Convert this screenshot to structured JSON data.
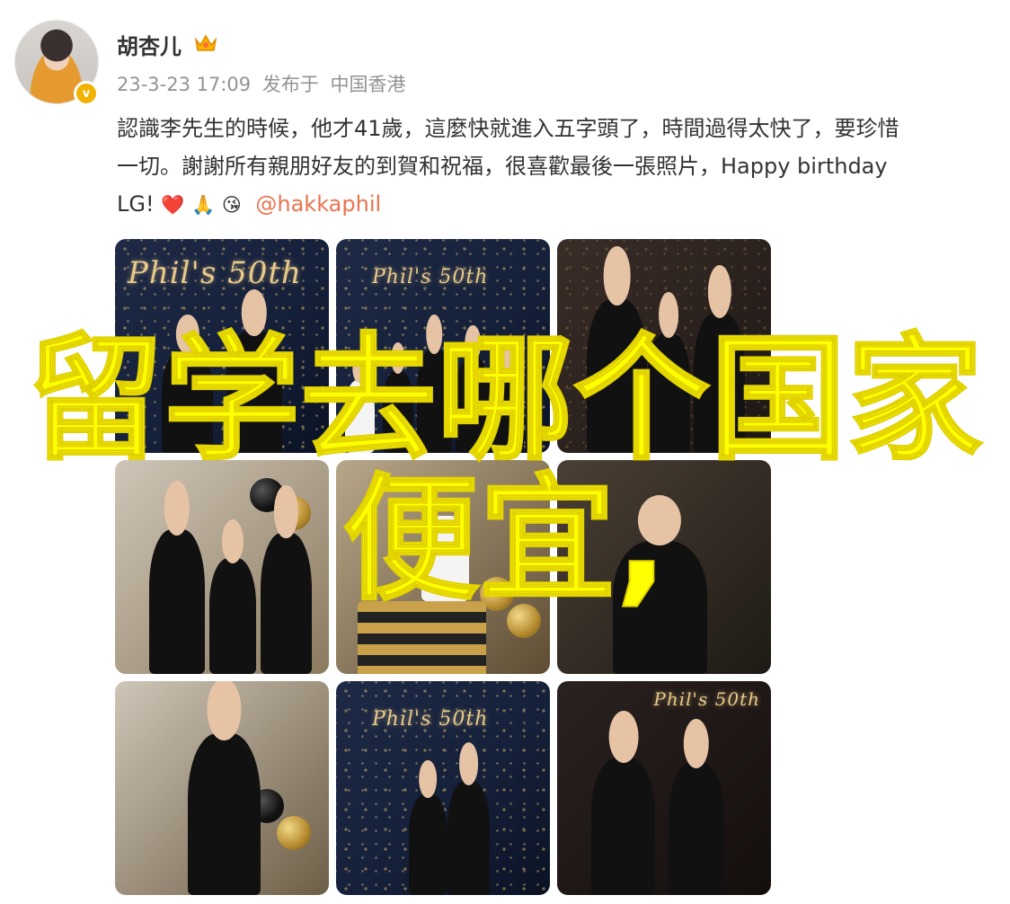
{
  "post": {
    "username": "胡杏儿",
    "crown_icon": "crown-icon",
    "verified_icon": "verified-badge-icon",
    "verified_mark": "v",
    "time": "23-3-23 17:09",
    "source": "发布于",
    "location": "中国香港",
    "text_line1": "認識李先生的時候，他才41歲，這麼快就進入五字頭了，時間過得太快了，要珍惜",
    "text_line2": "一切。謝謝所有親朋好友的到賀和祝福，很喜歡最後一張照片，Happy birthday",
    "text_line3_prefix": "LG!",
    "emoji_heart": "❤️",
    "emoji_pray": "🙏",
    "emoji_kiss": "😘",
    "mention": "@hakkaphil"
  },
  "photos": [
    {
      "sign": "Phil's 50th"
    },
    {
      "sign": "Phil's 50th"
    },
    {
      "sign": ""
    },
    {
      "sign": ""
    },
    {
      "sign": ""
    },
    {
      "sign": ""
    },
    {
      "sign": ""
    },
    {
      "sign": "Phil's 50th"
    },
    {
      "sign": "Phil's 50th"
    }
  ],
  "overlay": {
    "line1": "留学去哪个国家",
    "line2": "便宜,"
  },
  "colors": {
    "overlay_text": "#ffff00",
    "mention": "#eb7350",
    "meta": "#939393"
  }
}
